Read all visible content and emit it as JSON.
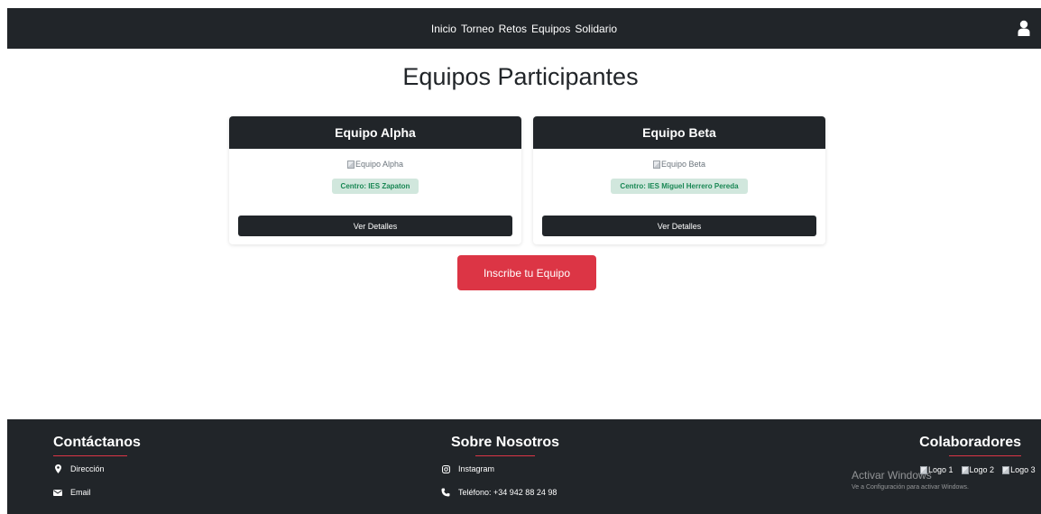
{
  "nav": {
    "items": [
      "Inicio",
      "Torneo",
      "Retos",
      "Equipos",
      "Solidario"
    ]
  },
  "page": {
    "title": "Equipos Participantes"
  },
  "teams": [
    {
      "name": "Equipo Alpha",
      "image_alt": "Equipo Alpha",
      "center": "Centro: IES Zapaton",
      "button": "Ver Detalles"
    },
    {
      "name": "Equipo Beta",
      "image_alt": "Equipo Beta",
      "center": "Centro: IES Miguel Herrero Pereda",
      "button": "Ver Detalles"
    }
  ],
  "cta": {
    "label": "Inscribe tu Equipo"
  },
  "footer": {
    "contact": {
      "title": "Contáctanos",
      "address": "Dirección",
      "email": "Email"
    },
    "about": {
      "title": "Sobre Nosotros",
      "instagram": "Instagram",
      "phone": "Teléfono: +34 942 88 24 98"
    },
    "collaborators": {
      "title": "Colaboradores",
      "logos": [
        "Logo 1",
        "Logo 2",
        "Logo 3"
      ]
    }
  },
  "watermark": {
    "line1": "Activar Windows",
    "line2": "Ve a Configuración para activar Windows."
  },
  "colors": {
    "dark": "#212529",
    "accent": "#dc3545",
    "badge_bg": "#d1e7dd",
    "badge_text": "#198754"
  },
  "icons": [
    "user-icon",
    "map-marker-icon",
    "envelope-icon",
    "instagram-icon",
    "phone-icon"
  ]
}
